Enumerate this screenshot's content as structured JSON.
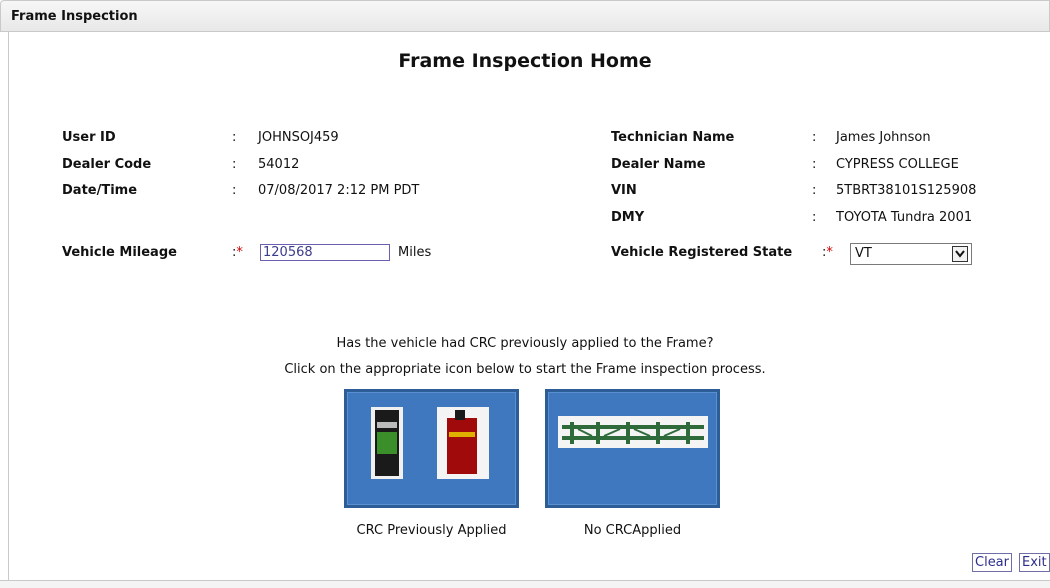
{
  "window": {
    "title": "Frame Inspection"
  },
  "page": {
    "heading": "Frame Inspection Home"
  },
  "fields": {
    "user_id": {
      "label": "User ID",
      "sep": ":",
      "value": "JOHNSOJ459"
    },
    "dealer_code": {
      "label": "Dealer Code",
      "sep": ":",
      "value": "54012"
    },
    "date_time": {
      "label": "Date/Time",
      "sep": ":",
      "value": "07/08/2017 2:12 PM PDT"
    },
    "technician_name": {
      "label": "Technician Name",
      "sep": ":",
      "value": "James Johnson"
    },
    "dealer_name": {
      "label": "Dealer Name",
      "sep": ":",
      "value": "CYPRESS COLLEGE"
    },
    "vin": {
      "label": "VIN",
      "sep": ":",
      "value": "5TBRT38101S125908"
    },
    "dmy": {
      "label": "DMY",
      "sep": ":",
      "value": "TOYOTA Tundra 2001"
    },
    "vehicle_mileage": {
      "label": "Vehicle Mileage",
      "sep": ":",
      "required_mark": "*",
      "value": "120568",
      "unit": "Miles"
    },
    "registered_state": {
      "label": "Vehicle Registered State",
      "sep": ":",
      "required_mark": "*",
      "selected": "VT"
    }
  },
  "prompt": {
    "question": "Has the vehicle had CRC previously applied to the Frame?",
    "instruction": "Click on the appropriate icon below to start the Frame inspection process."
  },
  "options": [
    {
      "caption": "CRC Previously Applied",
      "icon": "crc-cans-icon"
    },
    {
      "caption": "No CRCApplied",
      "icon": "vehicle-frame-icon"
    }
  ],
  "actions": {
    "clear_label": "Clear",
    "exit_label": "Exit"
  },
  "colors": {
    "tile_blue": "#3f78bf",
    "required_red": "#d00000",
    "link_blue": "#2e2e8c"
  }
}
